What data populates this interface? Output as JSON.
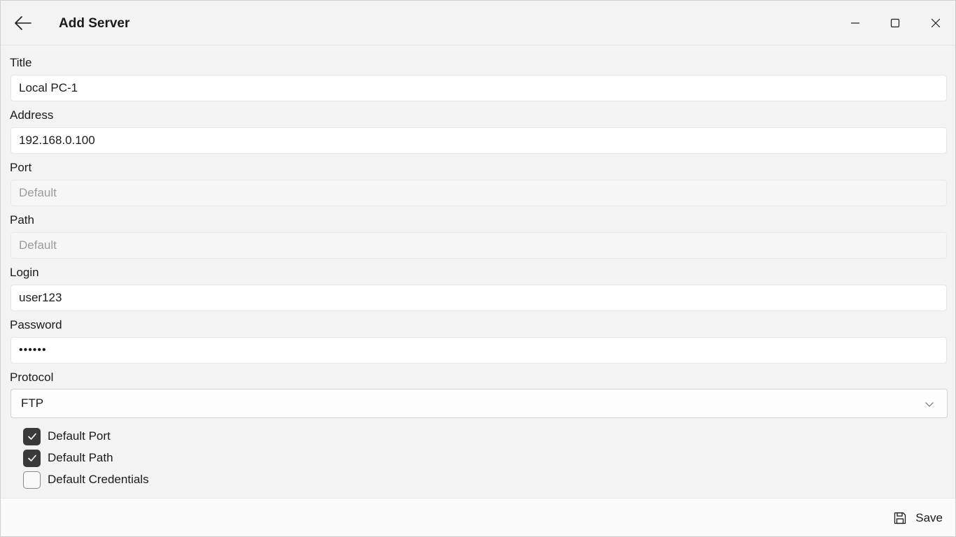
{
  "window": {
    "title": "Add Server"
  },
  "form": {
    "title": {
      "label": "Title",
      "value": "Local PC-1"
    },
    "address": {
      "label": "Address",
      "value": "192.168.0.100"
    },
    "port": {
      "label": "Port",
      "placeholder": "Default"
    },
    "path": {
      "label": "Path",
      "placeholder": "Default"
    },
    "login": {
      "label": "Login",
      "value": "user123"
    },
    "password": {
      "label": "Password",
      "value": "••••••"
    },
    "protocol": {
      "label": "Protocol",
      "selected": "FTP"
    }
  },
  "checkboxes": {
    "default_port": {
      "label": "Default Port",
      "checked": true
    },
    "default_path": {
      "label": "Default Path",
      "checked": true
    },
    "default_credentials": {
      "label": "Default Credentials",
      "checked": false
    }
  },
  "footer": {
    "save_label": "Save"
  },
  "icons": {
    "back": "back-arrow-icon",
    "minimize": "minimize-icon",
    "maximize": "maximize-icon",
    "close": "close-icon",
    "chevron": "chevron-down-icon",
    "check": "checkmark-icon",
    "save": "floppy-disk-icon"
  },
  "colors": {
    "window_bg": "#f3f3f3",
    "input_bg": "#ffffff",
    "checkbox_checked": "#3a3a3a"
  }
}
